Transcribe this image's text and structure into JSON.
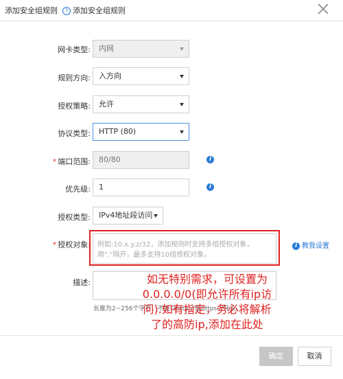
{
  "dialog": {
    "title": "添加安全组规则",
    "help_icon": "help-circle-icon",
    "help_text": "添加安全组规则",
    "close_icon": "close-icon"
  },
  "form": {
    "nic_type": {
      "label": "网卡类型:",
      "value": "内网"
    },
    "direction": {
      "label": "规则方向:",
      "value": "入方向"
    },
    "policy": {
      "label": "授权策略:",
      "value": "允许"
    },
    "protocol": {
      "label": "协议类型:",
      "value": "HTTP (80)"
    },
    "port_range": {
      "label": "端口范围:",
      "required_mark": "*",
      "value": "80/80"
    },
    "priority": {
      "label": "优先级:",
      "value": "1"
    },
    "auth_type": {
      "label": "授权类型:",
      "value": "IPv4地址段访问"
    },
    "auth_object": {
      "label": "授权对象:",
      "required_mark": "*",
      "placeholder": "例如:10.x.y.z/32，添加规则时支持多组授权对象，用\",\"隔开，最多支持10组授权对象。",
      "tutorial_link": "教我设置"
    },
    "description": {
      "label": "描述:",
      "hint": "长度为2~256个字符，不能以http://或https://开头。"
    },
    "info_icon": "info-icon"
  },
  "annotation": {
    "lines": [
      "如无特别需求，可设置为",
      "0.0.0.0/0(即允许所有ip访",
      "问).如有指定，务必将解析",
      "了的高防ip,添加在此处"
    ],
    "color": "#e02020"
  },
  "footer": {
    "ok_label": "确定",
    "cancel_label": "取消"
  }
}
